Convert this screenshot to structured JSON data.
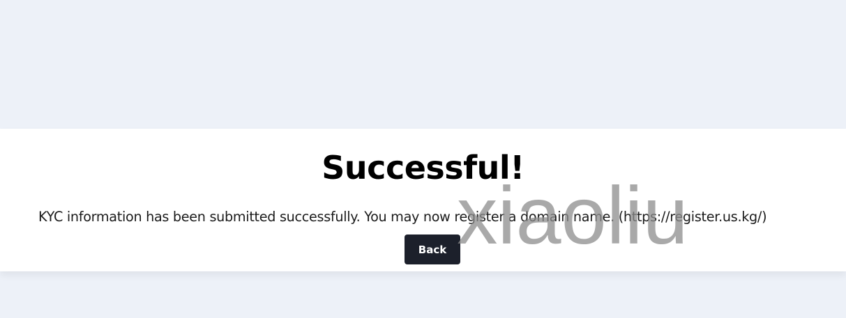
{
  "card": {
    "title": "Successful!",
    "message": "KYC information has been submitted successfully. You may now register a domain name. (https://register.us.kg/)",
    "back_label": "Back"
  },
  "watermark": {
    "text": "xiaoliu"
  },
  "colors": {
    "page_background": "#edf1f8",
    "card_background": "#ffffff",
    "button_background": "#1c202b",
    "button_text": "#ffffff",
    "watermark": "#8c8c8c"
  }
}
